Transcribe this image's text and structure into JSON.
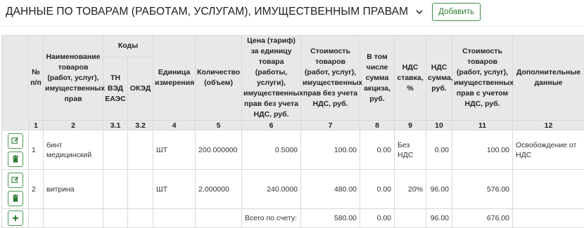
{
  "header": {
    "title": "ДАННЫЕ ПО ТОВАРАМ (РАБОТАМ, УСЛУГАМ), ИМУЩЕСТВЕННЫМ ПРАВАМ",
    "add_label": "Добавить"
  },
  "table": {
    "headers": {
      "num": "№ п/п",
      "name": "Наименование товаров (работ, услуг), имущественных прав",
      "codes": "Коды",
      "tnved": "ТН ВЭД ЕАЭС",
      "okei": "ОКЭД",
      "unit": "Единица измерения",
      "qty": "Количество (объем)",
      "price": "Цена (тариф) за единицу товара (работы, услуги), имущественных прав без учета НДС, руб.",
      "cost": "Стоимость товаров (работ, услуг), имущественных прав без учета НДС, руб.",
      "excise": "В том числе сумма акциза, руб.",
      "vat_rate": "НДС ставка, %",
      "vat_sum": "НДС сумма, руб.",
      "total": "Стоимость товаров (работ, услуг), имущественных прав с учетом НДС, руб.",
      "extra": "Дополнительные данные"
    },
    "colnums": [
      "1",
      "2",
      "3.1",
      "3.2",
      "4",
      "5",
      "6",
      "7",
      "8",
      "9",
      "10",
      "11",
      "12"
    ],
    "rows": [
      {
        "num": "1",
        "name": "бинт медицинский",
        "tnved": "",
        "okei": "",
        "unit": "ШТ",
        "qty": "200.000000",
        "price": "0.5000",
        "cost": "100.00",
        "excise": "0.00",
        "vat_rate": "Без НДС",
        "vat_sum": "0.00",
        "total": "100.00",
        "extra": "Освобождение от НДС"
      },
      {
        "num": "2",
        "name": "витрина",
        "tnved": "",
        "okei": "",
        "unit": "ШТ",
        "qty": "2.000000",
        "price": "240.0000",
        "cost": "480.00",
        "excise": "0.00",
        "vat_rate": "20%",
        "vat_sum": "96.00",
        "total": "576.00",
        "extra": ""
      }
    ],
    "totals": {
      "label": "Всего по счету:",
      "cost": "580.00",
      "excise": "0.00",
      "vat_sum": "96.00",
      "total": "676.00"
    }
  },
  "icons": {
    "edit": "edit-icon",
    "delete": "trash-icon",
    "add": "plus-icon",
    "expand": "chevron-down-icon"
  },
  "colors": {
    "accent": "#2e7d32",
    "header_bg": "#e7e8ea",
    "border": "#d9d9d9"
  }
}
